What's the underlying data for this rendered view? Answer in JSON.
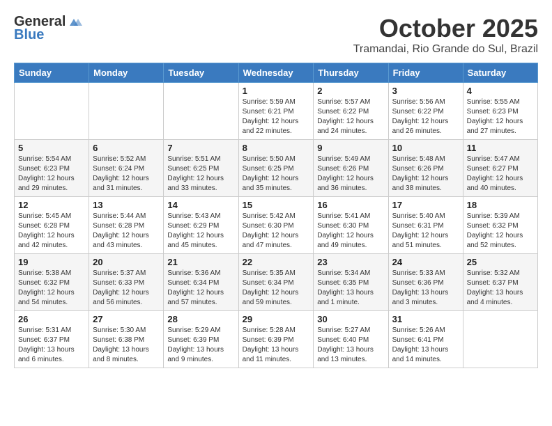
{
  "header": {
    "logo_line1": "General",
    "logo_line2": "Blue",
    "title": "October 2025",
    "subtitle": "Tramandai, Rio Grande do Sul, Brazil"
  },
  "weekdays": [
    "Sunday",
    "Monday",
    "Tuesday",
    "Wednesday",
    "Thursday",
    "Friday",
    "Saturday"
  ],
  "weeks": [
    [
      {
        "day": "",
        "info": ""
      },
      {
        "day": "",
        "info": ""
      },
      {
        "day": "",
        "info": ""
      },
      {
        "day": "1",
        "info": "Sunrise: 5:59 AM\nSunset: 6:21 PM\nDaylight: 12 hours and 22 minutes."
      },
      {
        "day": "2",
        "info": "Sunrise: 5:57 AM\nSunset: 6:22 PM\nDaylight: 12 hours and 24 minutes."
      },
      {
        "day": "3",
        "info": "Sunrise: 5:56 AM\nSunset: 6:22 PM\nDaylight: 12 hours and 26 minutes."
      },
      {
        "day": "4",
        "info": "Sunrise: 5:55 AM\nSunset: 6:23 PM\nDaylight: 12 hours and 27 minutes."
      }
    ],
    [
      {
        "day": "5",
        "info": "Sunrise: 5:54 AM\nSunset: 6:23 PM\nDaylight: 12 hours and 29 minutes."
      },
      {
        "day": "6",
        "info": "Sunrise: 5:52 AM\nSunset: 6:24 PM\nDaylight: 12 hours and 31 minutes."
      },
      {
        "day": "7",
        "info": "Sunrise: 5:51 AM\nSunset: 6:25 PM\nDaylight: 12 hours and 33 minutes."
      },
      {
        "day": "8",
        "info": "Sunrise: 5:50 AM\nSunset: 6:25 PM\nDaylight: 12 hours and 35 minutes."
      },
      {
        "day": "9",
        "info": "Sunrise: 5:49 AM\nSunset: 6:26 PM\nDaylight: 12 hours and 36 minutes."
      },
      {
        "day": "10",
        "info": "Sunrise: 5:48 AM\nSunset: 6:26 PM\nDaylight: 12 hours and 38 minutes."
      },
      {
        "day": "11",
        "info": "Sunrise: 5:47 AM\nSunset: 6:27 PM\nDaylight: 12 hours and 40 minutes."
      }
    ],
    [
      {
        "day": "12",
        "info": "Sunrise: 5:45 AM\nSunset: 6:28 PM\nDaylight: 12 hours and 42 minutes."
      },
      {
        "day": "13",
        "info": "Sunrise: 5:44 AM\nSunset: 6:28 PM\nDaylight: 12 hours and 43 minutes."
      },
      {
        "day": "14",
        "info": "Sunrise: 5:43 AM\nSunset: 6:29 PM\nDaylight: 12 hours and 45 minutes."
      },
      {
        "day": "15",
        "info": "Sunrise: 5:42 AM\nSunset: 6:30 PM\nDaylight: 12 hours and 47 minutes."
      },
      {
        "day": "16",
        "info": "Sunrise: 5:41 AM\nSunset: 6:30 PM\nDaylight: 12 hours and 49 minutes."
      },
      {
        "day": "17",
        "info": "Sunrise: 5:40 AM\nSunset: 6:31 PM\nDaylight: 12 hours and 51 minutes."
      },
      {
        "day": "18",
        "info": "Sunrise: 5:39 AM\nSunset: 6:32 PM\nDaylight: 12 hours and 52 minutes."
      }
    ],
    [
      {
        "day": "19",
        "info": "Sunrise: 5:38 AM\nSunset: 6:32 PM\nDaylight: 12 hours and 54 minutes."
      },
      {
        "day": "20",
        "info": "Sunrise: 5:37 AM\nSunset: 6:33 PM\nDaylight: 12 hours and 56 minutes."
      },
      {
        "day": "21",
        "info": "Sunrise: 5:36 AM\nSunset: 6:34 PM\nDaylight: 12 hours and 57 minutes."
      },
      {
        "day": "22",
        "info": "Sunrise: 5:35 AM\nSunset: 6:34 PM\nDaylight: 12 hours and 59 minutes."
      },
      {
        "day": "23",
        "info": "Sunrise: 5:34 AM\nSunset: 6:35 PM\nDaylight: 13 hours and 1 minute."
      },
      {
        "day": "24",
        "info": "Sunrise: 5:33 AM\nSunset: 6:36 PM\nDaylight: 13 hours and 3 minutes."
      },
      {
        "day": "25",
        "info": "Sunrise: 5:32 AM\nSunset: 6:37 PM\nDaylight: 13 hours and 4 minutes."
      }
    ],
    [
      {
        "day": "26",
        "info": "Sunrise: 5:31 AM\nSunset: 6:37 PM\nDaylight: 13 hours and 6 minutes."
      },
      {
        "day": "27",
        "info": "Sunrise: 5:30 AM\nSunset: 6:38 PM\nDaylight: 13 hours and 8 minutes."
      },
      {
        "day": "28",
        "info": "Sunrise: 5:29 AM\nSunset: 6:39 PM\nDaylight: 13 hours and 9 minutes."
      },
      {
        "day": "29",
        "info": "Sunrise: 5:28 AM\nSunset: 6:39 PM\nDaylight: 13 hours and 11 minutes."
      },
      {
        "day": "30",
        "info": "Sunrise: 5:27 AM\nSunset: 6:40 PM\nDaylight: 13 hours and 13 minutes."
      },
      {
        "day": "31",
        "info": "Sunrise: 5:26 AM\nSunset: 6:41 PM\nDaylight: 13 hours and 14 minutes."
      },
      {
        "day": "",
        "info": ""
      }
    ]
  ]
}
